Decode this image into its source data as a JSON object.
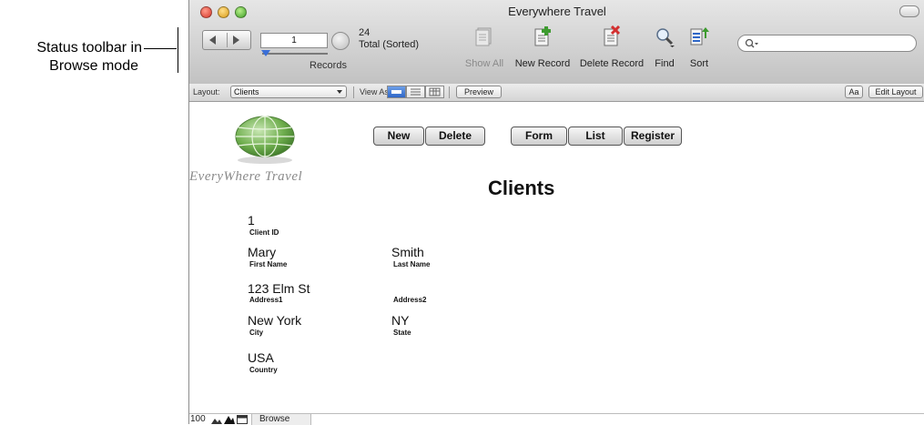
{
  "annotation": {
    "line1": "Status toolbar in",
    "line2": "Browse mode"
  },
  "window": {
    "title": "Everywhere Travel"
  },
  "toolbar": {
    "record_number": "1",
    "total_count": "24",
    "total_label": "Total (Sorted)",
    "records_label": "Records",
    "buttons": [
      {
        "label": "Show All",
        "icon": "show-all-icon",
        "enabled": false
      },
      {
        "label": "New Record",
        "icon": "new-record-icon",
        "enabled": true
      },
      {
        "label": "Delete Record",
        "icon": "delete-record-icon",
        "enabled": true
      },
      {
        "label": "Find",
        "icon": "find-icon",
        "enabled": true
      },
      {
        "label": "Sort",
        "icon": "sort-icon",
        "enabled": true
      }
    ],
    "search_placeholder": ""
  },
  "layout_bar": {
    "layout_label": "Layout:",
    "layout_value": "Clients",
    "view_as_label": "View As:",
    "view_as_selected": "form",
    "preview_label": "Preview",
    "aa_label": "Aa",
    "edit_layout_label": "Edit Layout"
  },
  "content": {
    "brand": "EveryWhere Travel",
    "nav_buttons": [
      "New",
      "Delete",
      "Form",
      "List",
      "Register"
    ],
    "heading": "Clients",
    "fields": {
      "client_id": {
        "value": "1",
        "label": "Client ID"
      },
      "first_name": {
        "value": "Mary",
        "label": "First Name"
      },
      "last_name": {
        "value": "Smith",
        "label": "Last Name"
      },
      "address1": {
        "value": "123 Elm St",
        "label": "Address1"
      },
      "address2": {
        "value": "",
        "label": "Address2"
      },
      "city": {
        "value": "New York",
        "label": "City"
      },
      "state": {
        "value": "NY",
        "label": "State"
      },
      "country": {
        "value": "USA",
        "label": "Country"
      }
    }
  },
  "status_bar": {
    "zoom": "100",
    "mode": "Browse"
  },
  "colors": {
    "accent_blue": "#2f67c7",
    "delete_red": "#d32f2f",
    "new_green": "#3d9b2f",
    "brand_gray": "#8a8a8a"
  }
}
